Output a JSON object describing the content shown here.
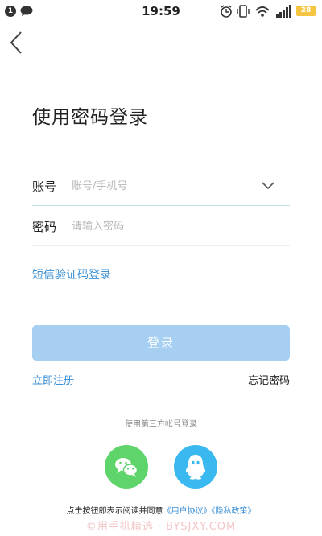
{
  "status_bar": {
    "notification_count": "1",
    "time": "19:59",
    "battery": "28"
  },
  "page": {
    "title": "使用密码登录"
  },
  "form": {
    "account_label": "账号",
    "account_placeholder": "账号/手机号",
    "password_label": "密码",
    "password_placeholder": "请输入密码"
  },
  "links": {
    "sms_login": "短信验证码登录",
    "register": "立即注册",
    "forgot_password": "忘记密码"
  },
  "buttons": {
    "login": "登录"
  },
  "third_party": {
    "heading": "使用第三方帐号登录",
    "icons": [
      "wechat-icon",
      "qq-icon"
    ]
  },
  "agreement": {
    "prefix": "点击按钮即表示阅读并同意",
    "user_agreement": "《用户协议》",
    "privacy_policy": "《隐私政策》"
  },
  "watermark": "©用手机精选 · BYSJXY.COM",
  "colors": {
    "accent": "#3a8fd5",
    "button_bg": "#a6cff2",
    "wechat": "#5fd46a",
    "qq": "#3ab8f0",
    "battery": "#f5c542"
  }
}
